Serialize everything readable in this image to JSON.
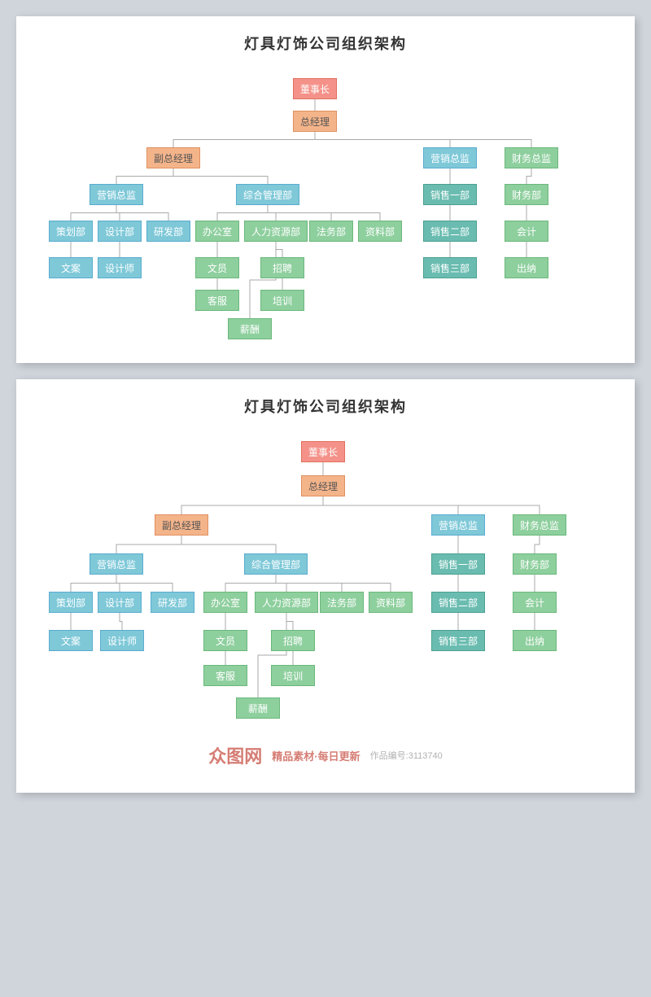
{
  "title1": "灯具灯饰公司组织架构",
  "title2": "灯具灯饰公司组织架构",
  "watermark": {
    "logo": "众图网",
    "tagline": "精品素材·每日更新",
    "workNumber": "作品编号:3113740"
  },
  "nodes": {
    "dongshizhang": "董事长",
    "zongjingli": "总经理",
    "fuzong": "副总经理",
    "yingxiaozongjian1": "营销总监",
    "caiwuzongjian": "财务总监",
    "yingxiaozongjian2": "营销总监",
    "zonghebu": "综合管理部",
    "cehuabu": "策划部",
    "shejibu": "设计部",
    "yanfabu": "研发部",
    "wenana": "文案",
    "shejishi": "设计师",
    "bangongshi": "办公室",
    "renlibu": "人力资源部",
    "fawubu": "法务部",
    "zilaobu": "资料部",
    "wenyuan": "文员",
    "zhaopin": "招聘",
    "kefu": "客服",
    "peixun": "培训",
    "xinchou": "薪酬",
    "xiaoshouyi": "销售一部",
    "xiaoshouer": "销售二部",
    "xiaoshousan": "销售三部",
    "caiwubu": "财务部",
    "kuaiji": "会计",
    "chuna": "出纳"
  }
}
